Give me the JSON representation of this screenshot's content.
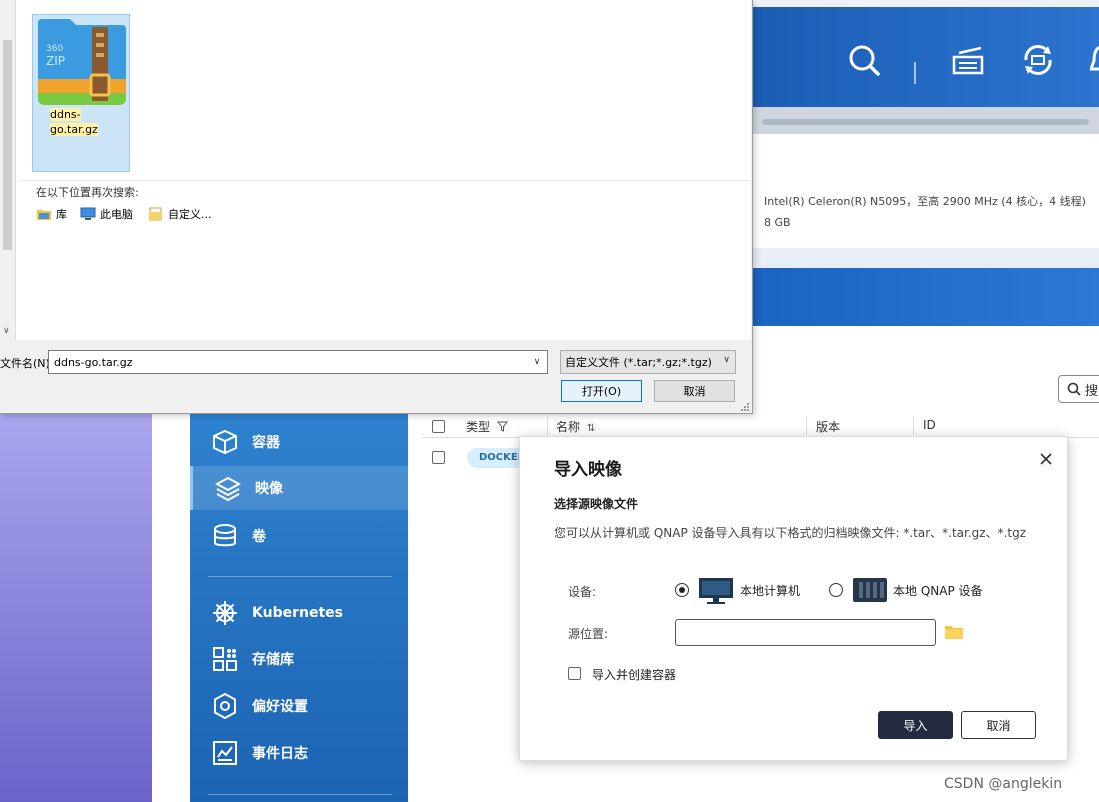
{
  "file_dialog": {
    "file_name": "ddns-go.tar.gz",
    "file_icon_text": "360 ZIP",
    "search_again_label": "在以下位置再次搜索:",
    "locations": [
      {
        "label": "库",
        "icon": "library-icon"
      },
      {
        "label": "此电脑",
        "icon": "computer-icon"
      },
      {
        "label": "自定义...",
        "icon": "custom-folder-icon"
      }
    ],
    "filename_label": "文件名(N):",
    "filename_value": "ddns-go.tar.gz",
    "filetype_value": "自定义文件 (*.tar;*.gz;*.tgz)",
    "open_label": "打开(O)",
    "cancel_label": "取消"
  },
  "background": {
    "cpu_info": "Intel(R) Celeron(R) N5095，至高 2900 MHz (4 核心，4 线程)",
    "memory": "8 GB",
    "search_placeholder": "搜"
  },
  "sidebar": {
    "items": [
      {
        "label": "容器",
        "icon": "container-cube-icon",
        "active": false
      },
      {
        "label": "映像",
        "icon": "image-layers-icon",
        "active": true
      },
      {
        "label": "卷",
        "icon": "volume-database-icon",
        "active": false
      },
      {
        "label": "Kubernetes",
        "icon": "kubernetes-helm-icon",
        "active": false
      },
      {
        "label": "存储库",
        "icon": "registry-grid-icon",
        "active": false
      },
      {
        "label": "偏好设置",
        "icon": "preferences-gear-icon",
        "active": false
      },
      {
        "label": "事件日志",
        "icon": "event-log-icon",
        "active": false
      }
    ]
  },
  "table": {
    "columns": [
      "类型",
      "名称",
      "版本",
      "ID"
    ],
    "rows": [
      {
        "type_badge": "DOCKER"
      }
    ]
  },
  "import_dialog": {
    "title": "导入映像",
    "section_title": "选择源映像文件",
    "description": "您可以从计算机或 QNAP 设备导入具有以下格式的归档映像文件: *.tar、*.tar.gz、*.tgz",
    "device_label": "设备:",
    "option_local_pc": "本地计算机",
    "option_local_qnap": "本地 QNAP 设备",
    "selected_option": "本地计算机",
    "source_label": "源位置:",
    "source_value": "",
    "create_container_label": "导入并创建容器",
    "create_container_checked": false,
    "import_label": "导入",
    "cancel_label": "取消"
  },
  "watermark": "CSDN @anglekin",
  "colors": {
    "header_blue": "#1b5db5",
    "sidebar_blue": "#2e82cf",
    "import_button": "#232a40",
    "docker_badge_bg": "#d7eefc",
    "selection_blue": "#cce4f7"
  }
}
